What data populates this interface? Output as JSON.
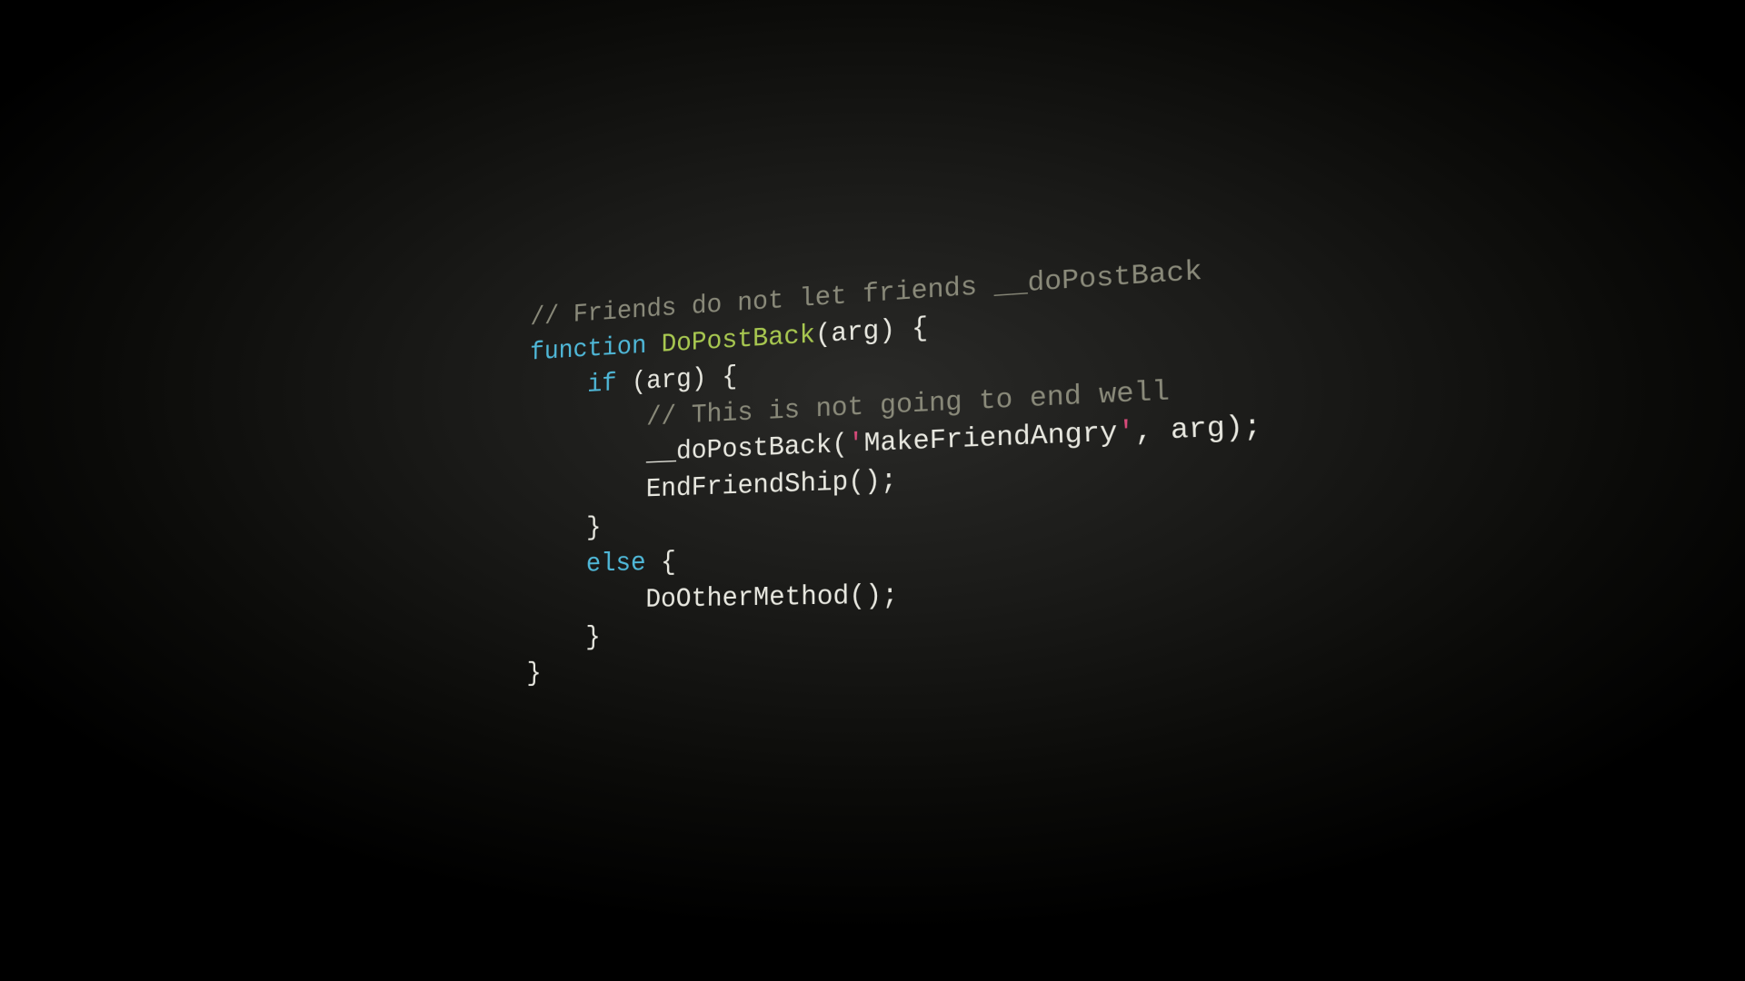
{
  "code": {
    "line1_comment": "// Friends do not let friends __doPostBack",
    "line2_keyword": "function",
    "line2_funcname": " DoPostBack",
    "line2_rest": "(arg) {",
    "line3_keyword": "    if",
    "line3_rest": " (arg) {",
    "line4_comment": "        // This is not going to end well",
    "line5_prefix": "        __doPostBack(",
    "line5_quote1": "'",
    "line5_string": "MakeFriendAngry",
    "line5_quote2": "'",
    "line5_suffix": ", arg);",
    "line6": "        EndFriendShip();",
    "line7": "    }",
    "line8_keyword": "    else",
    "line8_rest": " {",
    "line9": "        DoOtherMethod();",
    "line10": "    }",
    "line11": "}"
  }
}
